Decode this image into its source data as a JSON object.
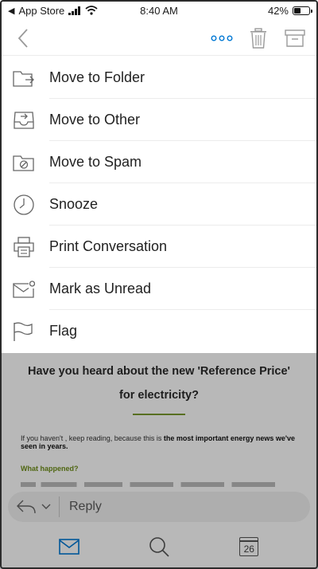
{
  "status_bar": {
    "carrier": "App Store",
    "time": "8:40 AM",
    "battery_text": "42%",
    "battery_level": 0.42
  },
  "toolbar": {
    "icons": [
      "back-chevron-icon",
      "more-dots-icon",
      "trash-icon",
      "archive-icon"
    ],
    "accent": "#0078d4"
  },
  "menu": {
    "items": [
      {
        "label": "Move to Folder",
        "icon": "folder-move-icon"
      },
      {
        "label": "Move to Other",
        "icon": "inbox-tray-icon"
      },
      {
        "label": "Move to Spam",
        "icon": "spam-folder-icon"
      },
      {
        "label": "Snooze",
        "icon": "clock-icon"
      },
      {
        "label": "Print Conversation",
        "icon": "printer-icon"
      },
      {
        "label": "Mark as Unread",
        "icon": "envelope-unread-icon"
      },
      {
        "label": "Flag",
        "icon": "flag-icon"
      }
    ]
  },
  "email": {
    "headline_1": "Have you heard about the new ",
    "headline_highlight": "'Reference Price'",
    "headline_2": "for electricity?",
    "intro": "If you haven't , keep reading, because this is ",
    "intro_bold": "the most important energy news we've seen in years.",
    "section_heading": "What happened?",
    "divider_color": "#7a9a2e"
  },
  "reply": {
    "placeholder": "Reply"
  },
  "tab_bar": {
    "calendar_day": "26",
    "icons": [
      "mail-icon",
      "search-icon",
      "calendar-icon"
    ]
  }
}
